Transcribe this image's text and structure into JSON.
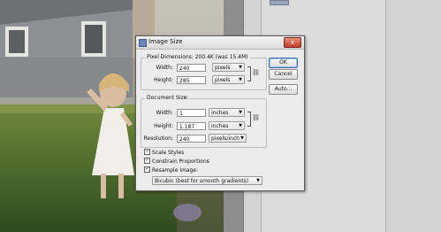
{
  "dialog": {
    "title": "Image Size",
    "close_label": "x",
    "pixel_dimensions": {
      "legend": "Pixel Dimensions: 200.4K (was 15.4M)",
      "width_label": "Width:",
      "width_value": "240",
      "width_unit": "pixels",
      "height_label": "Height:",
      "height_value": "285",
      "height_unit": "pixels"
    },
    "document_size": {
      "legend": "Document Size:",
      "width_label": "Width:",
      "width_value": "1",
      "width_unit": "inches",
      "height_label": "Height:",
      "height_value": "1.187",
      "height_unit": "inches",
      "resolution_label": "Resolution:",
      "resolution_value": "240",
      "resolution_unit": "pixels/inch"
    },
    "options": {
      "scale_styles": "Scale Styles",
      "constrain_proportions": "Constrain Proportions",
      "resample_image": "Resample Image:",
      "resample_method": "Bicubic (best for smooth gradients)"
    },
    "buttons": {
      "ok": "OK",
      "cancel": "Cancel",
      "auto": "Auto..."
    },
    "check_mark": "✓",
    "arrow": "▼"
  }
}
